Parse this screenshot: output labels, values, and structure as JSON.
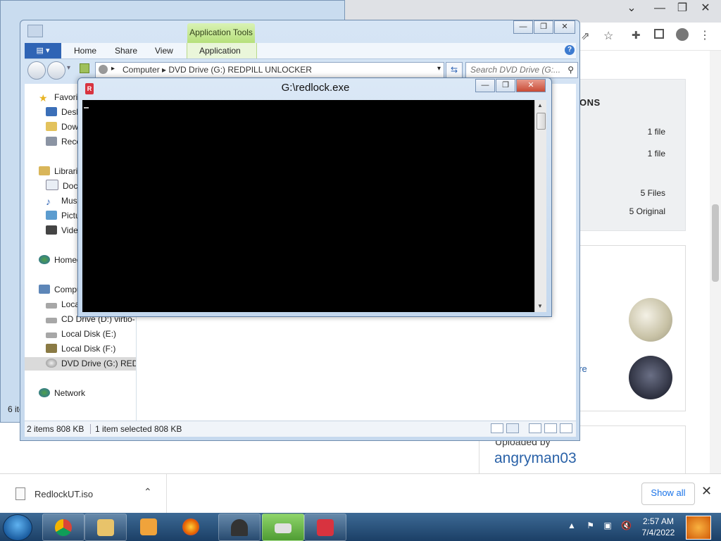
{
  "chrome": {
    "options_title": "ONS",
    "options_rows": [
      {
        "value": "1 file"
      },
      {
        "value": "1 file"
      },
      {
        "value": "5 Files"
      },
      {
        "value": "5 Original"
      }
    ],
    "partial_link": "are",
    "uploaded_by_label": "Uploaded by",
    "uploader": "angryman03"
  },
  "download_bar": {
    "filename": "RedlockUT.iso",
    "show_all": "Show all"
  },
  "bg_explorer": {
    "status": "6 ite"
  },
  "explorer": {
    "contextual_tab": "Application Tools",
    "ribbon_tabs": [
      "Home",
      "Share",
      "View",
      "Application"
    ],
    "address_path": "Computer  ▸  DVD Drive (G:) REDPILL UNLOCKER",
    "search_placeholder": "Search DVD Drive (G:...",
    "nav": {
      "favorites": "Favori",
      "desktop": "Deskt",
      "downloads": "Down",
      "recent": "Recen",
      "libraries": "Libraries",
      "documents": "Docu",
      "music": "Music",
      "pictures": "Pictur",
      "videos": "Video",
      "homegroup": "Homeg",
      "computer": "Compu",
      "local_c": "Local",
      "cd_drive": "CD Drive (D:) virtio-",
      "local_e": "Local Disk (E:)",
      "local_f": "Local Disk (F:)",
      "dvd_drive": "DVD Drive (G:) REDP",
      "network": "Network"
    },
    "status_items": "2 items  808 KB",
    "status_selected": "1 item selected  808 KB"
  },
  "console": {
    "title": "G:\\redlock.exe",
    "icon_letter": "R"
  },
  "taskbar": {
    "time": "2:57 AM",
    "date": "7/4/2022"
  },
  "colors": {
    "taskbar": "#1b3f66",
    "console_bg": "#000000",
    "link_blue": "#2a62a8",
    "app_tools_green": "#b6e07b"
  },
  "icons": [
    "start-orb-icon",
    "chrome-icon",
    "folder-icon",
    "media-player-icon",
    "firefox-icon",
    "chess-icon",
    "drive-icon",
    "redlock-icon",
    "flag-icon",
    "network-icon",
    "volume-muted-icon"
  ]
}
